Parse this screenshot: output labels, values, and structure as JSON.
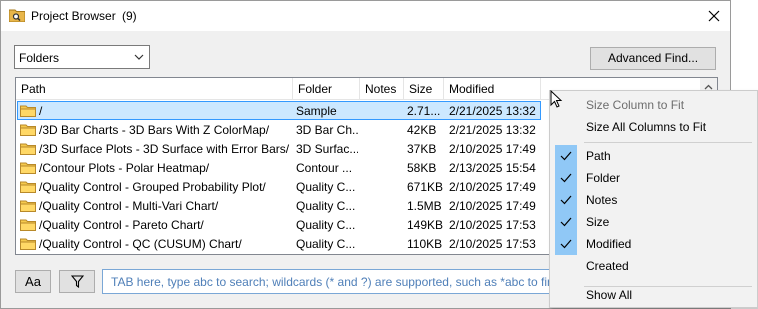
{
  "window": {
    "title": "Project Browser",
    "count": "(9)"
  },
  "toolbar": {
    "view_select": "Folders",
    "advanced_find_label": "Advanced Find..."
  },
  "columns": [
    "Path",
    "Folder",
    "Notes",
    "Size",
    "Modified"
  ],
  "rows": [
    {
      "path": "/",
      "folder": "Sample",
      "notes": "",
      "size": "2.71...",
      "modified": "2/21/2025 13:32",
      "selected": true
    },
    {
      "path": "/3D Bar Charts - 3D Bars With Z ColorMap/",
      "folder": "3D Bar Ch...",
      "notes": "",
      "size": "42KB",
      "modified": "2/21/2025 13:32"
    },
    {
      "path": "/3D Surface Plots - 3D Surface with Error Bars/",
      "folder": "3D Surfac...",
      "notes": "",
      "size": "37KB",
      "modified": "2/10/2025 17:49"
    },
    {
      "path": "/Contour Plots - Polar Heatmap/",
      "folder": "Contour ...",
      "notes": "",
      "size": "58KB",
      "modified": "2/13/2025 15:54"
    },
    {
      "path": "/Quality Control - Grouped Probability Plot/",
      "folder": "Quality C...",
      "notes": "",
      "size": "671KB",
      "modified": "2/10/2025 17:49"
    },
    {
      "path": "/Quality Control - Multi-Vari Chart/",
      "folder": "Quality C...",
      "notes": "",
      "size": "1.5MB",
      "modified": "2/10/2025 17:49"
    },
    {
      "path": "/Quality Control - Pareto Chart/",
      "folder": "Quality C...",
      "notes": "",
      "size": "149KB",
      "modified": "2/10/2025 17:53"
    },
    {
      "path": "/Quality Control - QC (CUSUM) Chart/",
      "folder": "Quality C...",
      "notes": "",
      "size": "110KB",
      "modified": "2/10/2025 17:53"
    }
  ],
  "bottom": {
    "case_label": "Aa",
    "search_placeholder": "TAB here, type abc to search; wildcards (* and ?) are supported, such as *abc to find"
  },
  "context_menu": {
    "size_column_to_fit": "Size Column to Fit",
    "size_all_columns_to_fit": "Size All Columns to Fit",
    "columns": [
      {
        "label": "Path",
        "checked": true
      },
      {
        "label": "Folder",
        "checked": true
      },
      {
        "label": "Notes",
        "checked": true
      },
      {
        "label": "Size",
        "checked": true
      },
      {
        "label": "Modified",
        "checked": true
      },
      {
        "label": "Created",
        "checked": false
      }
    ],
    "show_all": "Show All"
  },
  "colors": {
    "selection": "#cce8ff",
    "selection_border": "#3399ff",
    "check_bg": "#90c8f6",
    "placeholder": "#4f7fb8"
  }
}
